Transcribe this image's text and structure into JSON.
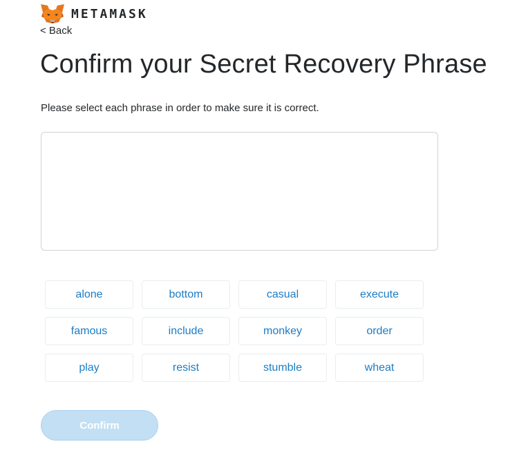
{
  "header": {
    "brand": "METAMASK",
    "logo_icon": "metamask-fox-icon"
  },
  "nav": {
    "back_label": "< Back"
  },
  "main": {
    "title": "Confirm your Secret Recovery Phrase",
    "instructions": "Please select each phrase in order to make sure it is correct.",
    "selected_words": [],
    "words": [
      "alone",
      "bottom",
      "casual",
      "execute",
      "famous",
      "include",
      "monkey",
      "order",
      "play",
      "resist",
      "stumble",
      "wheat"
    ],
    "confirm_label": "Confirm",
    "confirm_disabled": true
  },
  "colors": {
    "accent": "#1b7cc4",
    "disabled_button": "#c3dff4",
    "text": "#24272a",
    "fox_orange": "#e2761b"
  }
}
